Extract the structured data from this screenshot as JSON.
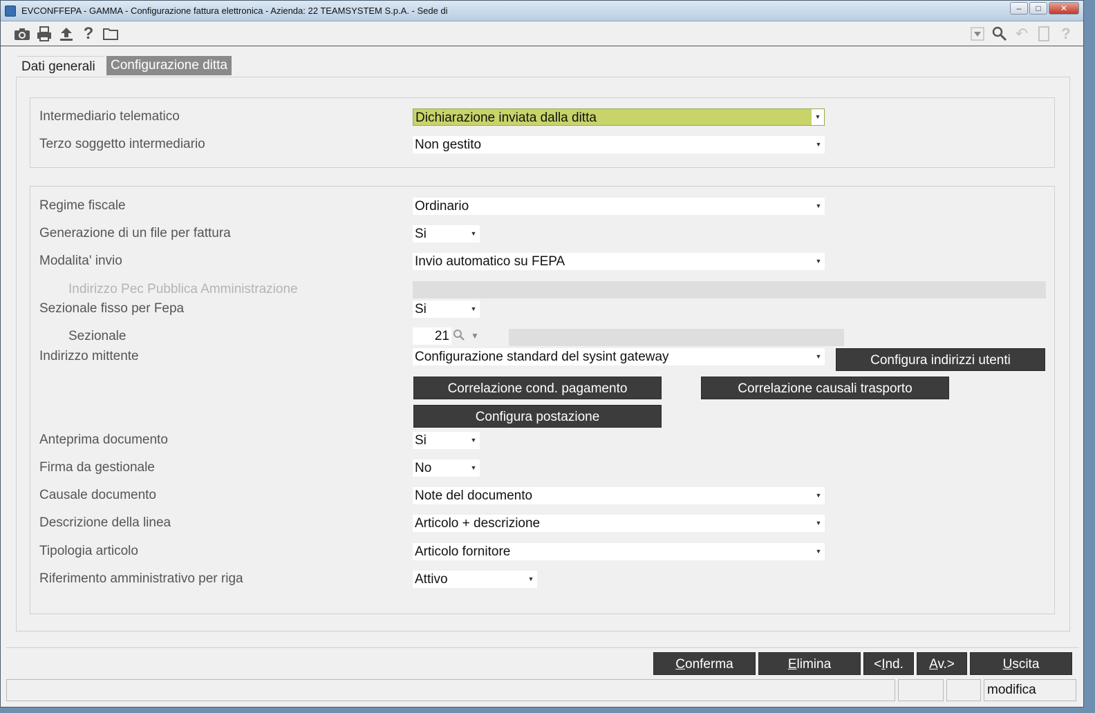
{
  "window": {
    "title": "EVCONFFEPA - GAMMA - Configurazione fattura elettronica - Azienda:   22 TEAMSYSTEM S.p.A. - Sede di"
  },
  "toolbar": {
    "icons": [
      "camera-icon",
      "printer-icon",
      "upload-icon",
      "help-icon",
      "folder-icon"
    ],
    "right_icons": [
      "filter-dropdown-icon",
      "search-icon",
      "undo-icon",
      "document-icon",
      "help-icon"
    ]
  },
  "tabs": [
    {
      "label": "Dati generali",
      "active": true
    },
    {
      "label": "Configurazione ditta",
      "active": false
    }
  ],
  "group1": {
    "intermediario": {
      "label": "Intermediario telematico",
      "value": "Dichiarazione inviata dalla ditta"
    },
    "terzo": {
      "label": "Terzo soggetto intermediario",
      "value": "Non gestito"
    }
  },
  "group2": {
    "regime": {
      "label": "Regime fiscale",
      "value": "Ordinario"
    },
    "generazione": {
      "label": "Generazione di un file per fattura",
      "value": "Si"
    },
    "modalita": {
      "label": "Modalita' invio",
      "value": "Invio automatico su FEPA"
    },
    "pec": {
      "label": "Indirizzo Pec Pubblica Amministrazione",
      "value": ""
    },
    "sezionale_fisso": {
      "label": "Sezionale fisso per Fepa",
      "value": "Si"
    },
    "sezionale": {
      "label": "Sezionale",
      "value": "21"
    },
    "indirizzo_mittente": {
      "label": "Indirizzo mittente",
      "value": "Configurazione standard del sysint gateway"
    },
    "buttons": {
      "configura_indirizzi": "Configura indirizzi utenti",
      "correlazione_pagamento": "Correlazione cond. pagamento",
      "correlazione_trasporto": "Correlazione causali trasporto",
      "configura_postazione": "Configura postazione"
    },
    "anteprima": {
      "label": "Anteprima documento",
      "value": "Si"
    },
    "firma": {
      "label": "Firma da gestionale",
      "value": "No"
    },
    "causale": {
      "label": "Causale documento",
      "value": "Note del documento"
    },
    "descrizione": {
      "label": "Descrizione della linea",
      "value": "Articolo + descrizione"
    },
    "tipologia": {
      "label": "Tipologia articolo",
      "value": "Articolo fornitore"
    },
    "riferimento": {
      "label": "Riferimento amministrativo per riga",
      "value": "Attivo"
    }
  },
  "footer": {
    "conferma": {
      "first": "C",
      "rest": "onferma"
    },
    "elimina": {
      "first": "E",
      "rest": "limina"
    },
    "ind": {
      "pre": "<",
      "first": "I",
      "rest": "nd."
    },
    "av": {
      "first": "A",
      "rest": "v.>"
    },
    "uscita": {
      "first": "U",
      "rest": "scita"
    }
  },
  "status": {
    "mode": "modifica"
  },
  "colors": {
    "highlight": "#c8d46a",
    "button_dark": "#3c3c3c",
    "tab_inactive": "#8a8a8a"
  }
}
